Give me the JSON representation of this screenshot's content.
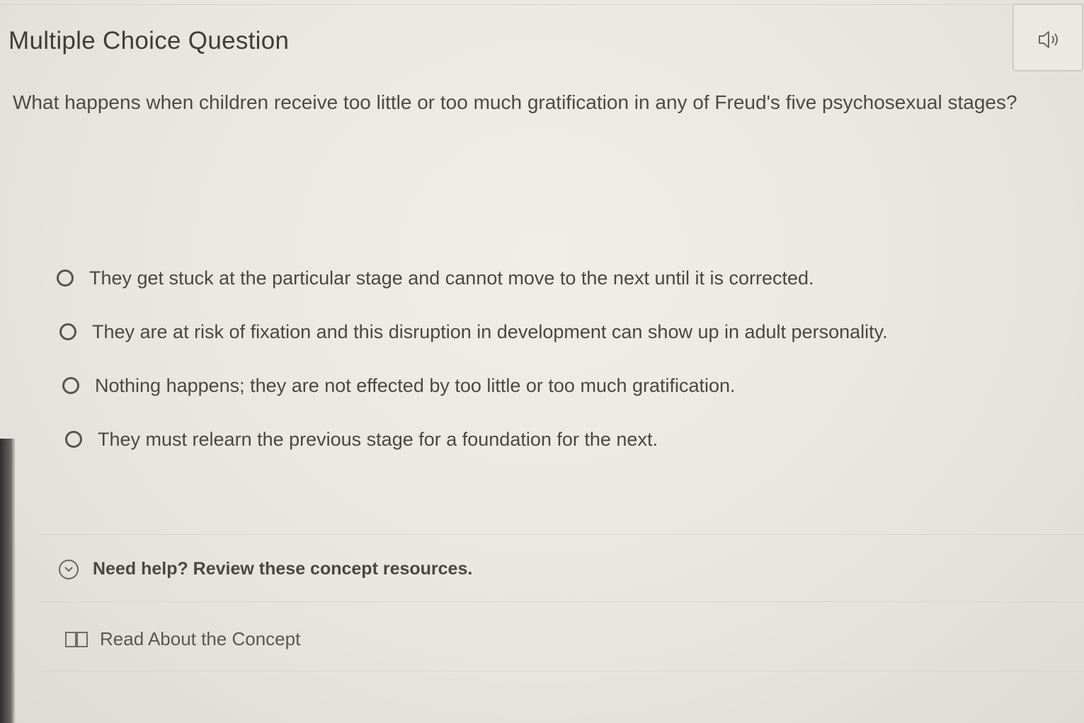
{
  "header": {
    "question_type": "Multiple Choice Question",
    "audio_icon": "speaker-icon"
  },
  "question": {
    "text": "What happens when children receive too little or too much gratification in any of Freud's five psychosexual stages?"
  },
  "options": [
    {
      "label": "They get stuck at the particular stage and cannot move to the next until it is corrected.",
      "selected": false
    },
    {
      "label": "They are at risk of fixation and this disruption in development can show up in adult personality.",
      "selected": false
    },
    {
      "label": "Nothing happens; they are not effected by too little or too much gratification.",
      "selected": false
    },
    {
      "label": "They must relearn the previous stage for a foundation for the next.",
      "selected": false
    }
  ],
  "help": {
    "toggle_label": "Need help? Review these concept resources.",
    "toggle_icon": "chevron-down-icon",
    "resources": [
      {
        "label": "Read About the Concept",
        "icon": "book-icon"
      }
    ]
  }
}
